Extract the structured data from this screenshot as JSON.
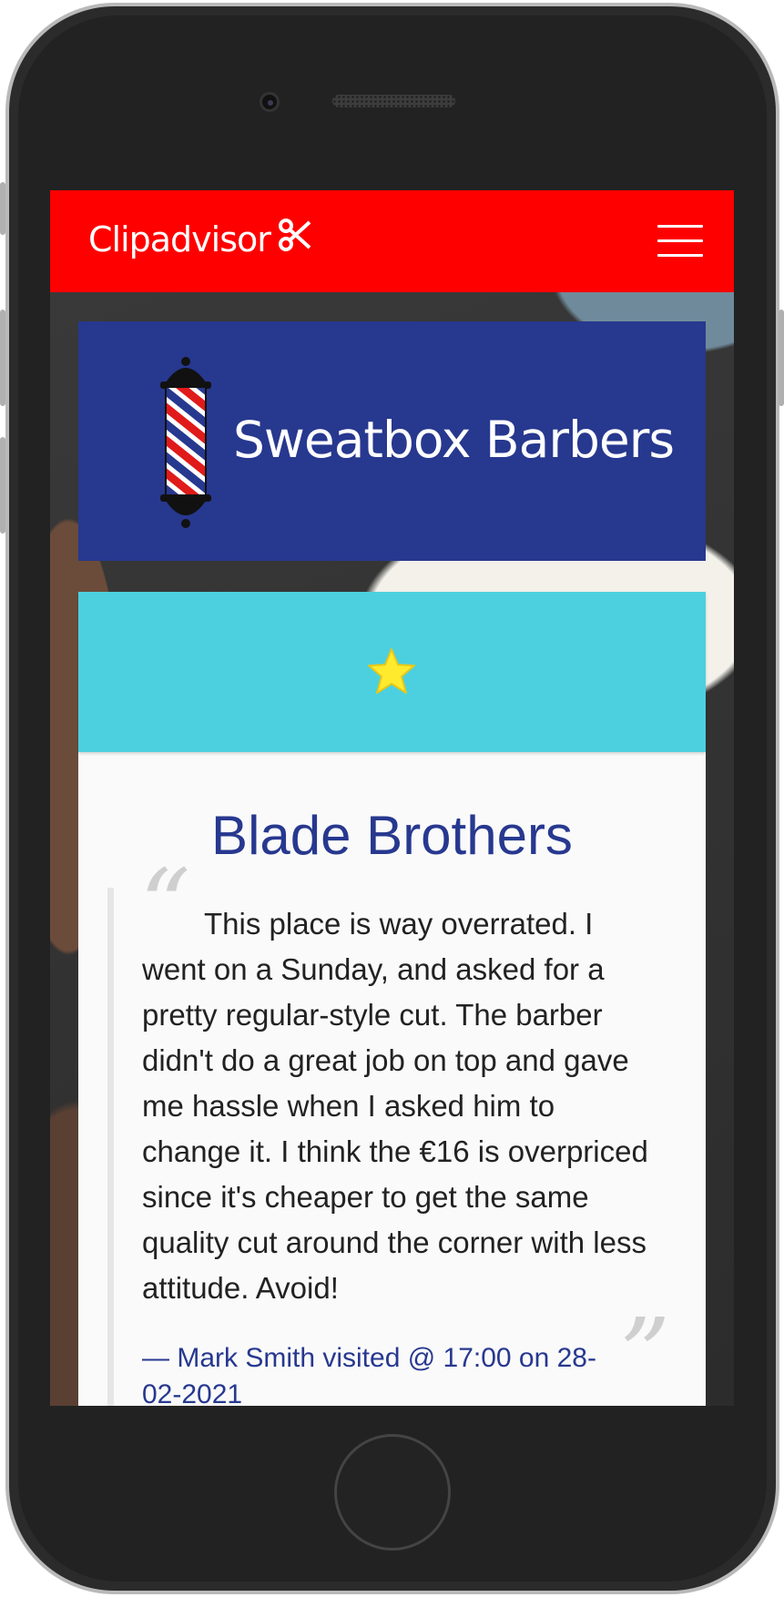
{
  "navbar": {
    "brand": "Clipadvisor",
    "brand_icon": "scissors-icon",
    "menu_icon": "hamburger-menu-icon",
    "background": "#ff0000"
  },
  "shop": {
    "name": "Sweatbox Barbers",
    "icon": "barber-pole-icon",
    "background": "#27388f"
  },
  "review": {
    "rating_stars": 1,
    "rating_icon": "star-icon",
    "header_color": "#4cd0df",
    "title": "Blade Brothers",
    "text": "This place is way overrated. I went on a Sunday, and asked for a pretty regular-style cut. The barber didn't do a great job on top and gave me hassle when I asked him to change it. I think the €16 is overpriced since it's cheaper to get the same quality cut around the corner with less attitude. Avoid!",
    "meta": "— Mark Smith visited @ 17:00 on 28-02-2021"
  }
}
